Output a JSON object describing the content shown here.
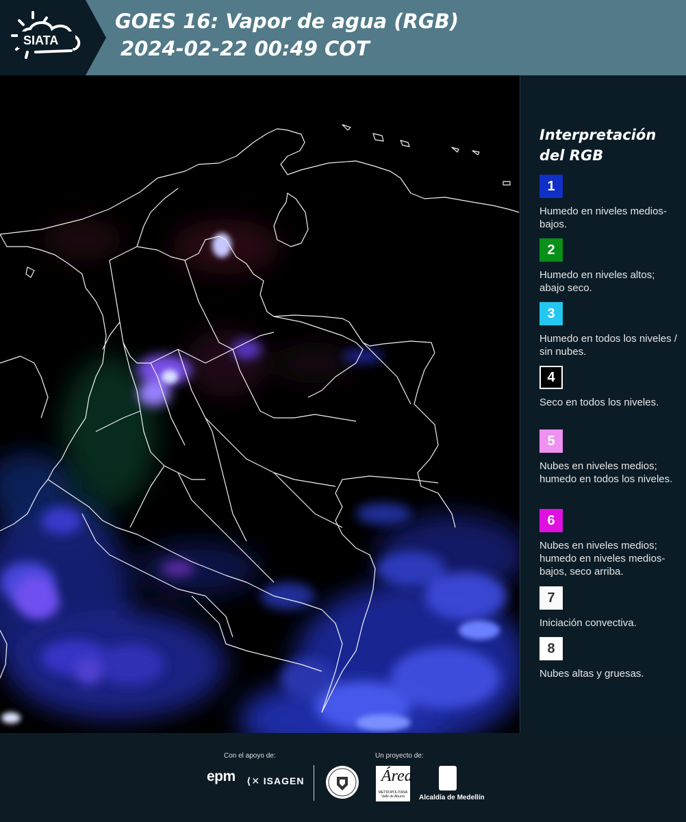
{
  "header": {
    "logo_text": "SIATA",
    "title_line1": "GOES 16: Vapor de agua (RGB)",
    "title_line2": "2024-02-22 00:49 COT"
  },
  "map": {
    "image_description_icon": "satellite-map",
    "colors": {
      "background": "#000000",
      "borders": "#f2f2f2",
      "moist_mid_low": "#3c3cff",
      "moist_deep": "#6b8cff",
      "high_clouds": "#c8d2ff",
      "mid_clouds": "#c850ff",
      "dry_upper": "#3a0a1a"
    }
  },
  "legend": {
    "title": "Interpretación del RGB",
    "items": [
      {
        "number": "1",
        "text": "Humedo en niveles medios-bajos.",
        "color": "#1030c8",
        "text_color": "#ffffff",
        "border": "none"
      },
      {
        "number": "2",
        "text": "Humedo en niveles altos; abajo seco.",
        "color": "#089018",
        "text_color": "#ffffff",
        "border": "none"
      },
      {
        "number": "3",
        "text": "Humedo en todos los niveles / sin nubes.",
        "color": "#22c8f0",
        "text_color": "#ffffff",
        "border": "none"
      },
      {
        "number": "4",
        "text": "Seco en todos los niveles.",
        "color": "#000000",
        "text_color": "#ffffff",
        "border": "#ffffff"
      },
      {
        "number": "5",
        "text": "Nubes en niveles medios; humedo en todos los niveles.",
        "color": "#f090f0",
        "text_color": "#ffffff",
        "border": "none"
      },
      {
        "number": "6",
        "text": "Nubes en niveles medios; humedo en niveles medios-bajos, seco arriba.",
        "color": "#e010e0",
        "text_color": "#ffffff",
        "border": "none"
      },
      {
        "number": "7",
        "text": "Iniciación convectiva.",
        "color": "#fafafa",
        "text_color": "#333333",
        "border": "none"
      },
      {
        "number": "8",
        "text": "Nubes altas y gruesas.",
        "color": "#ffffff",
        "text_color": "#333333",
        "border": "none"
      }
    ]
  },
  "footer": {
    "support_label": "Con el apoyo de:",
    "project_label": "Un proyecto de:",
    "epm": "epm",
    "isagen": "ISAGEN",
    "area_big": "Área",
    "area_small": "METROPOLITANA Valle de Aburrá",
    "alcaldia": "Alcaldía de Medellín"
  }
}
